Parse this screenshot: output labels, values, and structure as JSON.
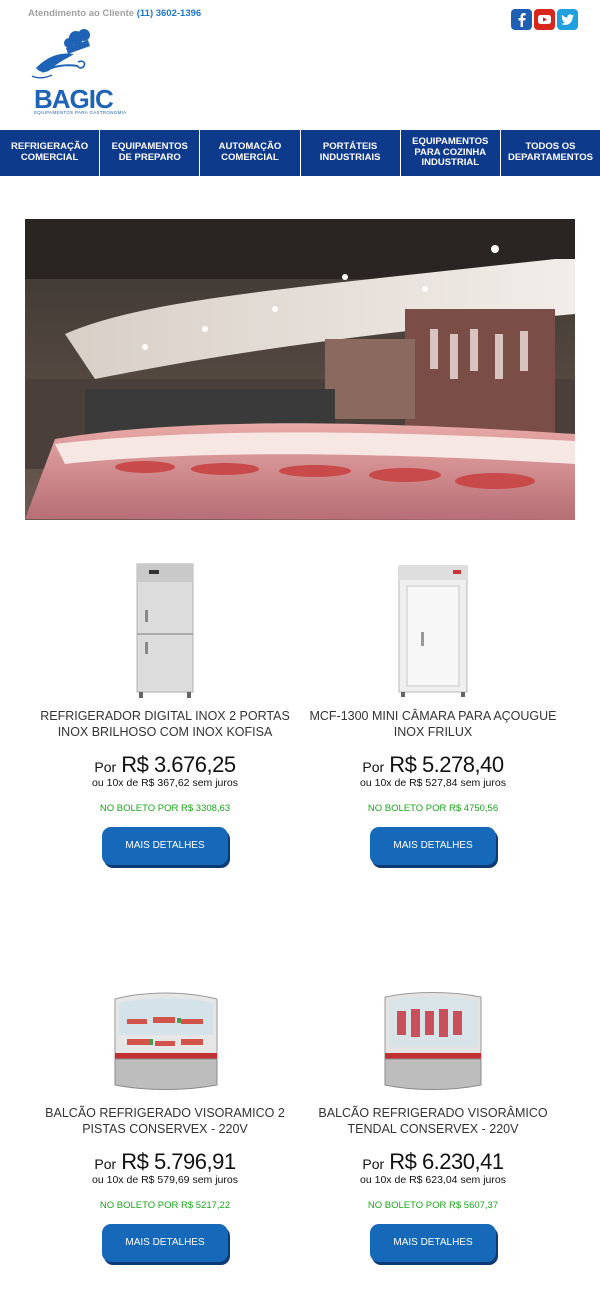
{
  "header": {
    "support_label": "Atendimento ao Cliente",
    "support_phone": "(11) 3602-1396",
    "logo_text": "BAGIC",
    "logo_subtitle": "EQUIPAMENTOS PARA GASTRONOMIA",
    "social": [
      {
        "icon": "facebook-icon",
        "color": "#1f5fb3"
      },
      {
        "icon": "youtube-icon",
        "color": "#d9261c"
      },
      {
        "icon": "twitter-icon",
        "color": "#21a0e0"
      }
    ]
  },
  "nav": {
    "items": [
      {
        "label": "REFRIGERAÇÃO COMERCIAL"
      },
      {
        "label": "EQUIPAMENTOS DE PREPARO"
      },
      {
        "label": "AUTOMAÇÃO COMERCIAL"
      },
      {
        "label": "PORTÁTEIS INDUSTRIAIS"
      },
      {
        "label": "EQUIPAMENTOS PARA COZINHA INDUSTRIAL"
      },
      {
        "label": "TODOS OS DEPARTAMENTOS"
      }
    ]
  },
  "products": [
    {
      "name": "REFRIGERADOR DIGITAL INOX 2 PORTAS INOX BRILHOSO COM INOX KOFISA",
      "price_prefix": "Por",
      "price": "R$ 3.676,25",
      "installments": "ou 10x de R$ 367,62 sem juros",
      "boleto": "NO BOLETO POR R$ 3308,63",
      "button": "MAIS DETALHES"
    },
    {
      "name": "MCF-1300 MINI CÂMARA PARA AÇOUGUE INOX FRILUX",
      "price_prefix": "Por",
      "price": "R$ 5.278,40",
      "installments": "ou 10x de R$ 527,84 sem juros",
      "boleto": "NO BOLETO POR R$ 4750,56",
      "button": "MAIS DETALHES"
    },
    {
      "name": "BALCÃO REFRIGERADO VISORAMICO 2 PISTAS CONSERVEX - 220V",
      "price_prefix": "Por",
      "price": "R$ 5.796,91",
      "installments": "ou 10x de R$ 579,69 sem juros",
      "boleto": "NO BOLETO POR R$ 5217,22",
      "button": "MAIS DETALHES"
    },
    {
      "name": "BALCÃO REFRIGERADO VISORÂMICO TENDAL CONSERVEX - 220V",
      "price_prefix": "Por",
      "price": "R$ 6.230,41",
      "installments": "ou 10x de R$ 623,04 sem juros",
      "boleto": "NO BOLETO POR R$ 5607,37",
      "button": "MAIS DETALHES"
    }
  ],
  "colors": {
    "nav_bg": "#0e3a8c",
    "brand_blue": "#1e63b5",
    "button_blue": "#1569b8",
    "boleto_green": "#1aa71a"
  }
}
